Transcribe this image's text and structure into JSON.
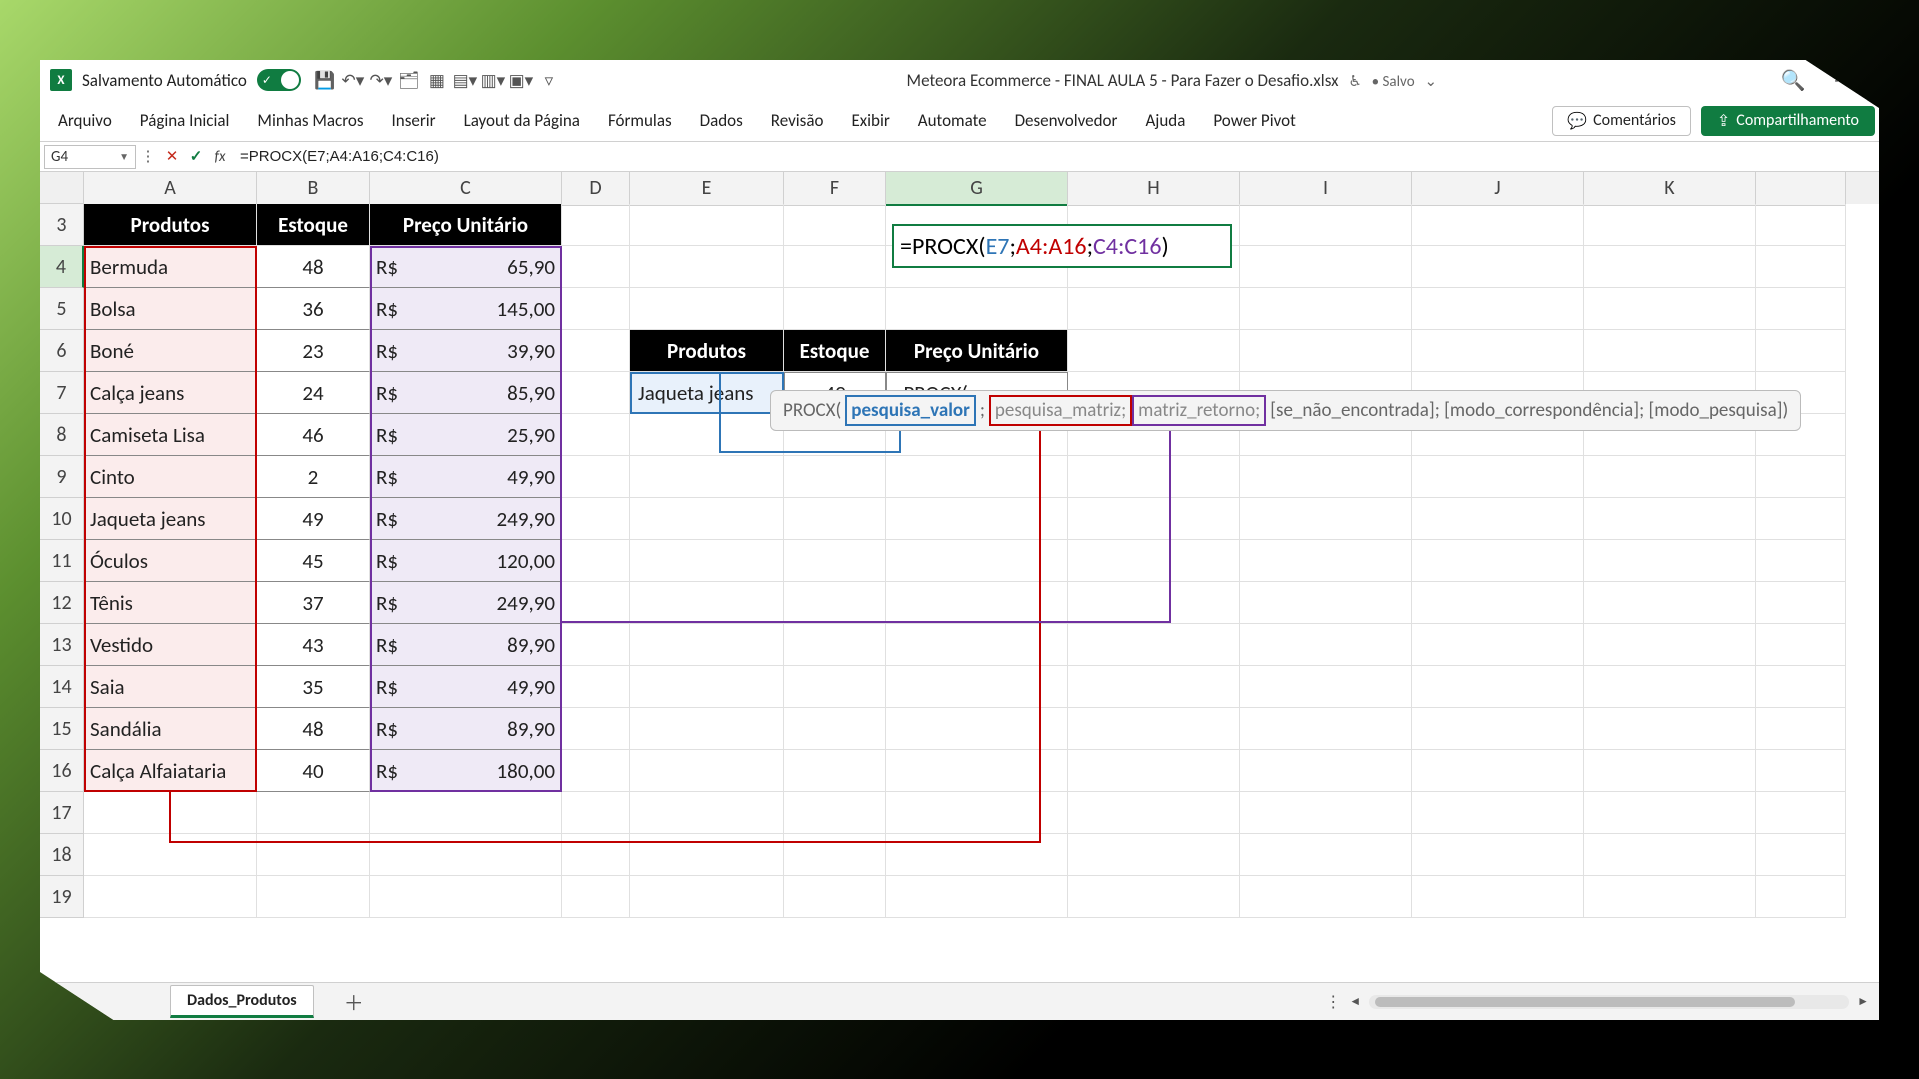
{
  "title": {
    "autosave_label": "Salvamento Automático",
    "filename": "Meteora Ecommerce - FINAL AULA 5 - Para Fazer o Desafio.xlsx",
    "save_status": "• Salvo",
    "minimize": "—"
  },
  "ribbon": {
    "tabs": [
      "Arquivo",
      "Página Inicial",
      "Minhas Macros",
      "Inserir",
      "Layout da Página",
      "Fórmulas",
      "Dados",
      "Revisão",
      "Exibir",
      "Automate",
      "Desenvolvedor",
      "Ajuda",
      "Power Pivot"
    ],
    "comments": "Comentários",
    "share": "Compartilhamento"
  },
  "fbar": {
    "name": "G4",
    "formula": "=PROCX(E7;A4:A16;C4:C16)"
  },
  "columns": [
    "A",
    "B",
    "C",
    "D",
    "E",
    "F",
    "G",
    "H",
    "I",
    "J",
    "K"
  ],
  "row_numbers": [
    3,
    4,
    5,
    6,
    7,
    8,
    9,
    10,
    11,
    12,
    13,
    14,
    15,
    16,
    17,
    18,
    19
  ],
  "active_col_index": 6,
  "active_row_number": 4,
  "table": {
    "headers": {
      "a": "Produtos",
      "b": "Estoque",
      "c": "Preço Unitário"
    },
    "rows": [
      {
        "a": "Bermuda",
        "b": "48",
        "rs": "R$",
        "c": "65,90"
      },
      {
        "a": "Bolsa",
        "b": "36",
        "rs": "R$",
        "c": "145,00"
      },
      {
        "a": "Boné",
        "b": "23",
        "rs": "R$",
        "c": "39,90"
      },
      {
        "a": "Calça jeans",
        "b": "24",
        "rs": "R$",
        "c": "85,90"
      },
      {
        "a": "Camiseta Lisa",
        "b": "46",
        "rs": "R$",
        "c": "25,90"
      },
      {
        "a": "Cinto",
        "b": "2",
        "rs": "R$",
        "c": "49,90"
      },
      {
        "a": "Jaqueta jeans",
        "b": "49",
        "rs": "R$",
        "c": "249,90"
      },
      {
        "a": "Óculos",
        "b": "45",
        "rs": "R$",
        "c": "120,00"
      },
      {
        "a": "Tênis",
        "b": "37",
        "rs": "R$",
        "c": "249,90"
      },
      {
        "a": "Vestido",
        "b": "43",
        "rs": "R$",
        "c": "89,90"
      },
      {
        "a": "Saia",
        "b": "35",
        "rs": "R$",
        "c": "49,90"
      },
      {
        "a": "Sandália",
        "b": "48",
        "rs": "R$",
        "c": "89,90"
      },
      {
        "a": "Calça Alfaiataria",
        "b": "40",
        "rs": "R$",
        "c": "180,00"
      }
    ]
  },
  "big_formula": {
    "p1": "=PROCX(",
    "p2": "E7",
    "sep": ";",
    "p3": "A4:A16",
    "p4": "C4:C16",
    "p5": ")"
  },
  "mini": {
    "headers": {
      "e": "Produtos",
      "f": "Estoque",
      "g": "Preço Unitário"
    },
    "row": {
      "e": "Jaqueta jeans",
      "f": "49",
      "g": "=PROCX("
    }
  },
  "tooltip": {
    "fn": "PROCX(",
    "a1": "pesquisa_valor",
    "a2": "pesquisa_matriz;",
    "a3": "matriz_retorno;",
    "a4": "[se_não_encontrada]; [modo_correspondência]; [modo_pesquisa])"
  },
  "sheet": {
    "name": "Dados_Produtos"
  }
}
